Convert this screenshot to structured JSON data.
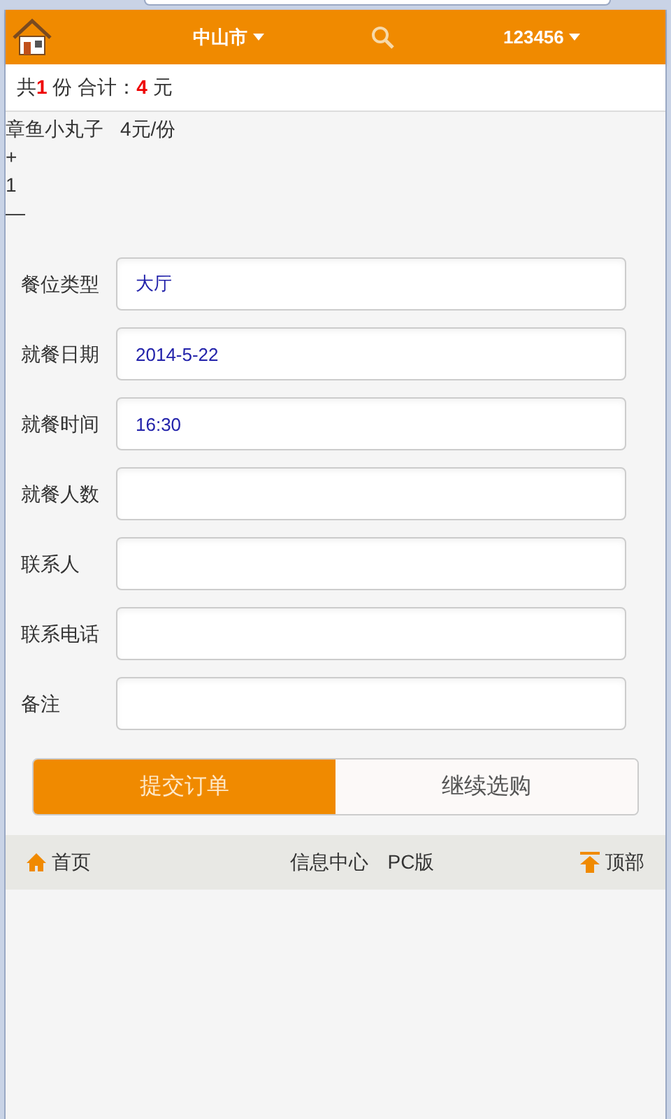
{
  "header": {
    "city": "中山市",
    "user": "123456"
  },
  "summary": "共**1** 份 合计：**4** 元",
  "item": {
    "name": "章鱼小丸子",
    "price": "4元/份",
    "plus": "+",
    "quantity": "1",
    "minus": "—"
  },
  "fields": [
    {
      "label": "餐位类型",
      "value": "大厅"
    },
    {
      "label": "就餐日期",
      "value": "2014-5-22"
    },
    {
      "label": "就餐时间",
      "value": "16:30"
    },
    {
      "label": "就餐人数"
    },
    {
      "label": "联系人"
    },
    {
      "label": "联系电话"
    },
    {
      "label": "备注"
    }
  ],
  "buttons": [
    {
      "label": "提交订单",
      "kind": "primary"
    },
    {
      "label": "继续选购",
      "kind": "secondary"
    }
  ],
  "footer": {
    "home": "首页",
    "links": [
      "信息中心",
      "PC版"
    ],
    "top": "顶部"
  }
}
